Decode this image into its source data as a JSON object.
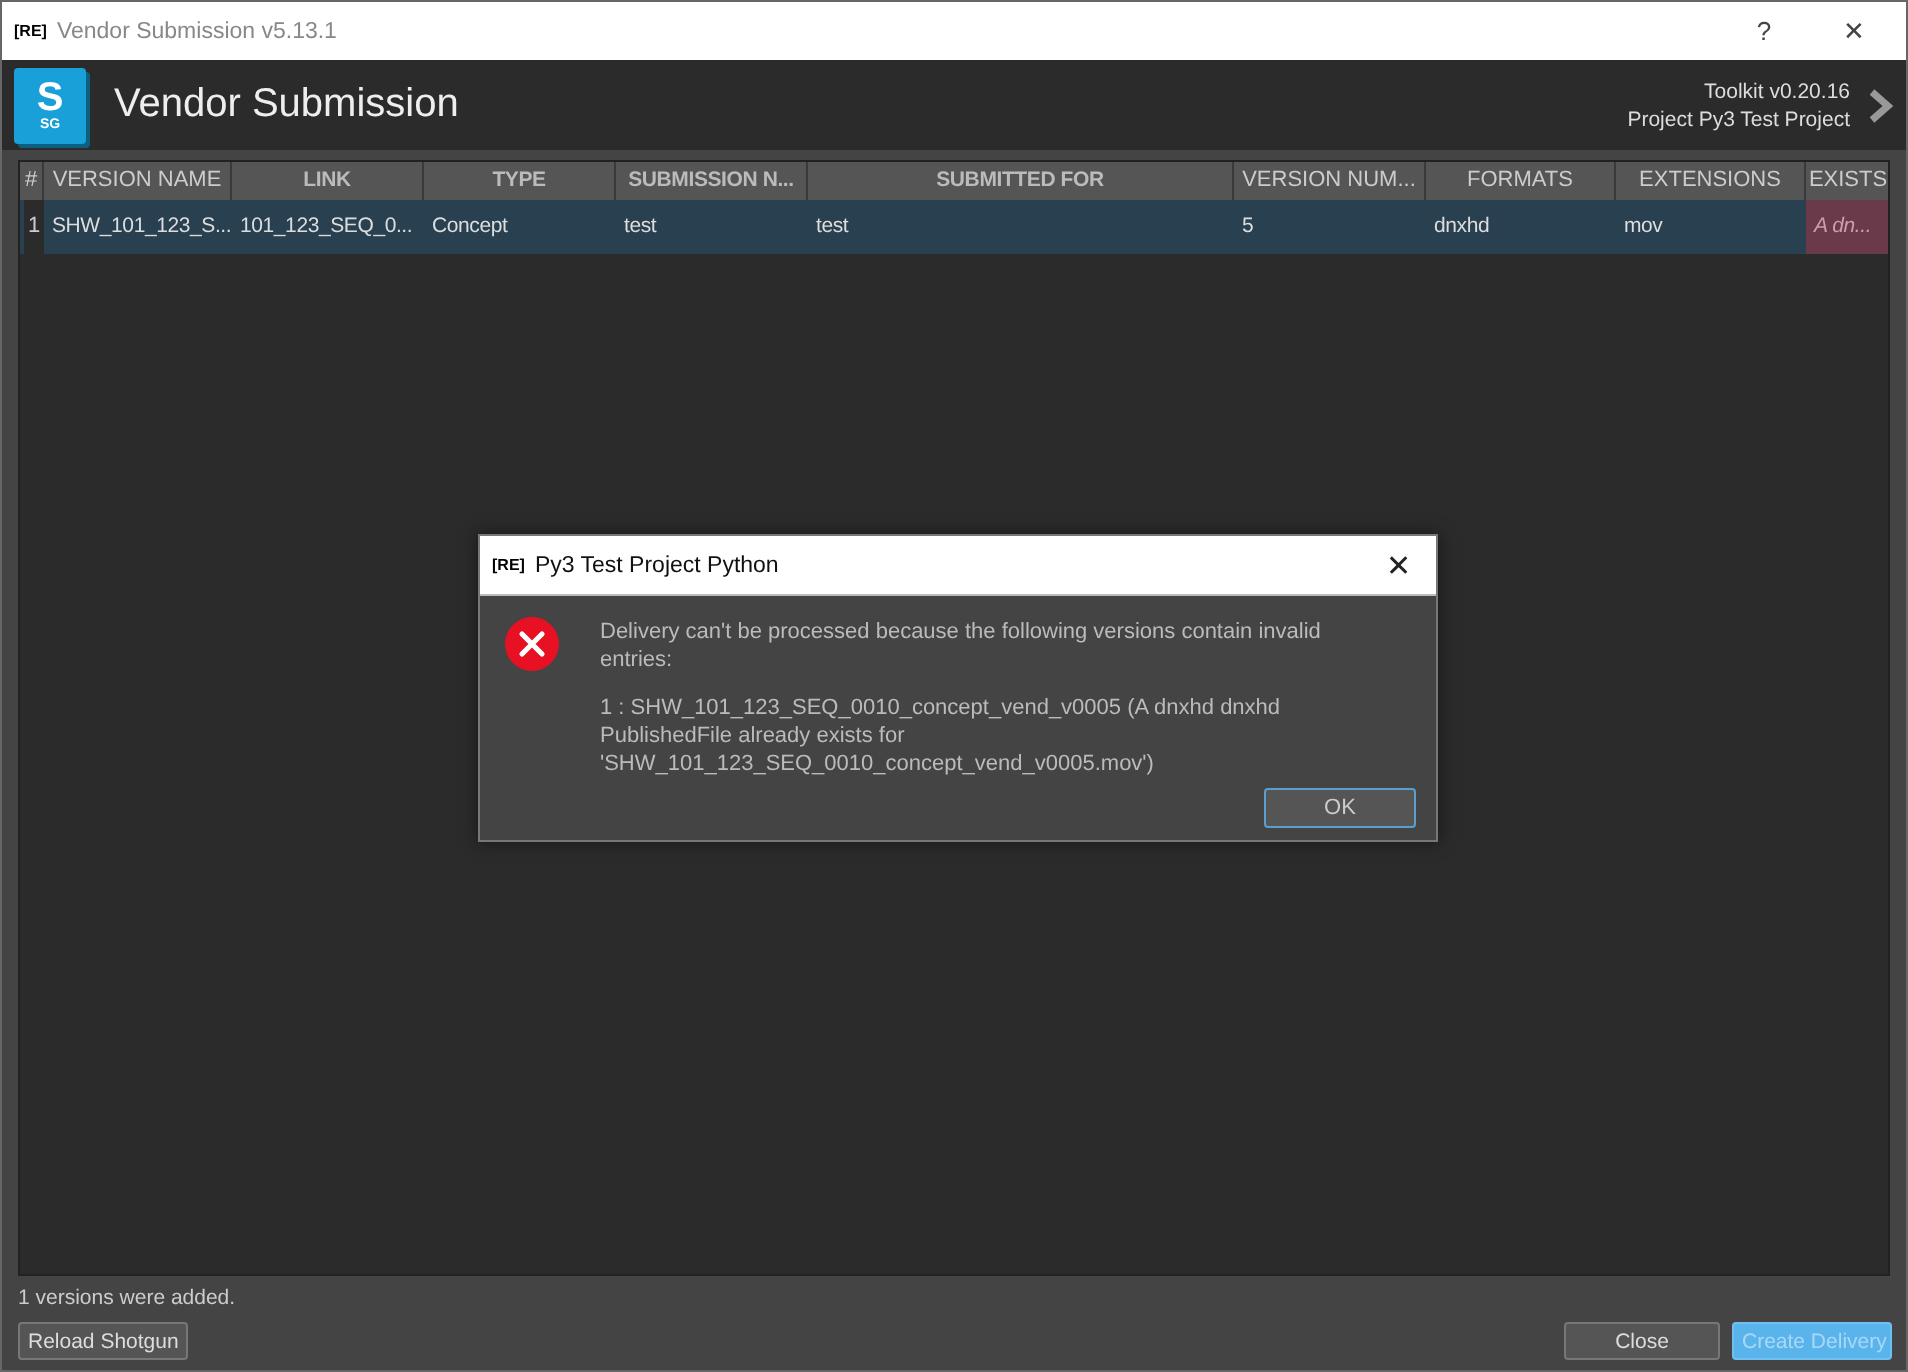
{
  "window": {
    "badge": "[RE]",
    "title": "Vendor Submission v5.13.1",
    "help": "?",
    "close": "✕"
  },
  "header": {
    "logo": "S",
    "logo_sub": "SG",
    "title": "Vendor Submission",
    "toolkit": "Toolkit v0.20.16",
    "project": "Project Py3 Test Project"
  },
  "table": {
    "columns": [
      {
        "label": "#",
        "bold": false
      },
      {
        "label": "VERSION NAME",
        "bold": false
      },
      {
        "label": "LINK",
        "bold": true
      },
      {
        "label": "TYPE",
        "bold": true
      },
      {
        "label": "SUBMISSION N...",
        "bold": true
      },
      {
        "label": "SUBMITTED FOR",
        "bold": true
      },
      {
        "label": "VERSION NUM...",
        "bold": false
      },
      {
        "label": "FORMATS",
        "bold": false
      },
      {
        "label": "EXTENSIONS",
        "bold": false
      },
      {
        "label": "EXISTS",
        "bold": false
      }
    ],
    "rows": [
      {
        "selected": true,
        "cells": [
          {
            "text": "1",
            "kind": "index"
          },
          {
            "text": "SHW_101_123_S...",
            "kind": "plain"
          },
          {
            "text": "101_123_SEQ_0...",
            "kind": "plain"
          },
          {
            "text": "Concept",
            "kind": "plain"
          },
          {
            "text": "test",
            "kind": "plain"
          },
          {
            "text": "test",
            "kind": "plain"
          },
          {
            "text": "5",
            "kind": "plain"
          },
          {
            "text": "dnxhd",
            "kind": "plain"
          },
          {
            "text": "mov",
            "kind": "plain"
          },
          {
            "text": "A dn...",
            "kind": "warning"
          }
        ]
      }
    ]
  },
  "dialog": {
    "badge": "[RE]",
    "title": "Py3 Test Project Python",
    "close": "✕",
    "message": "Delivery can't be processed because the following versions contain invalid entries:",
    "detail": "1 : SHW_101_123_SEQ_0010_concept_vend_v0005 (A dnxhd dnxhd PublishedFile already exists for 'SHW_101_123_SEQ_0010_concept_vend_v0005.mov')",
    "button": "OK"
  },
  "status": "1 versions were added.",
  "buttons": [
    {
      "label": "Reload Shotgun",
      "kind": "normal"
    },
    {
      "label": "Close",
      "kind": "normal"
    },
    {
      "label": "Create Delivery",
      "kind": "primary"
    }
  ]
}
